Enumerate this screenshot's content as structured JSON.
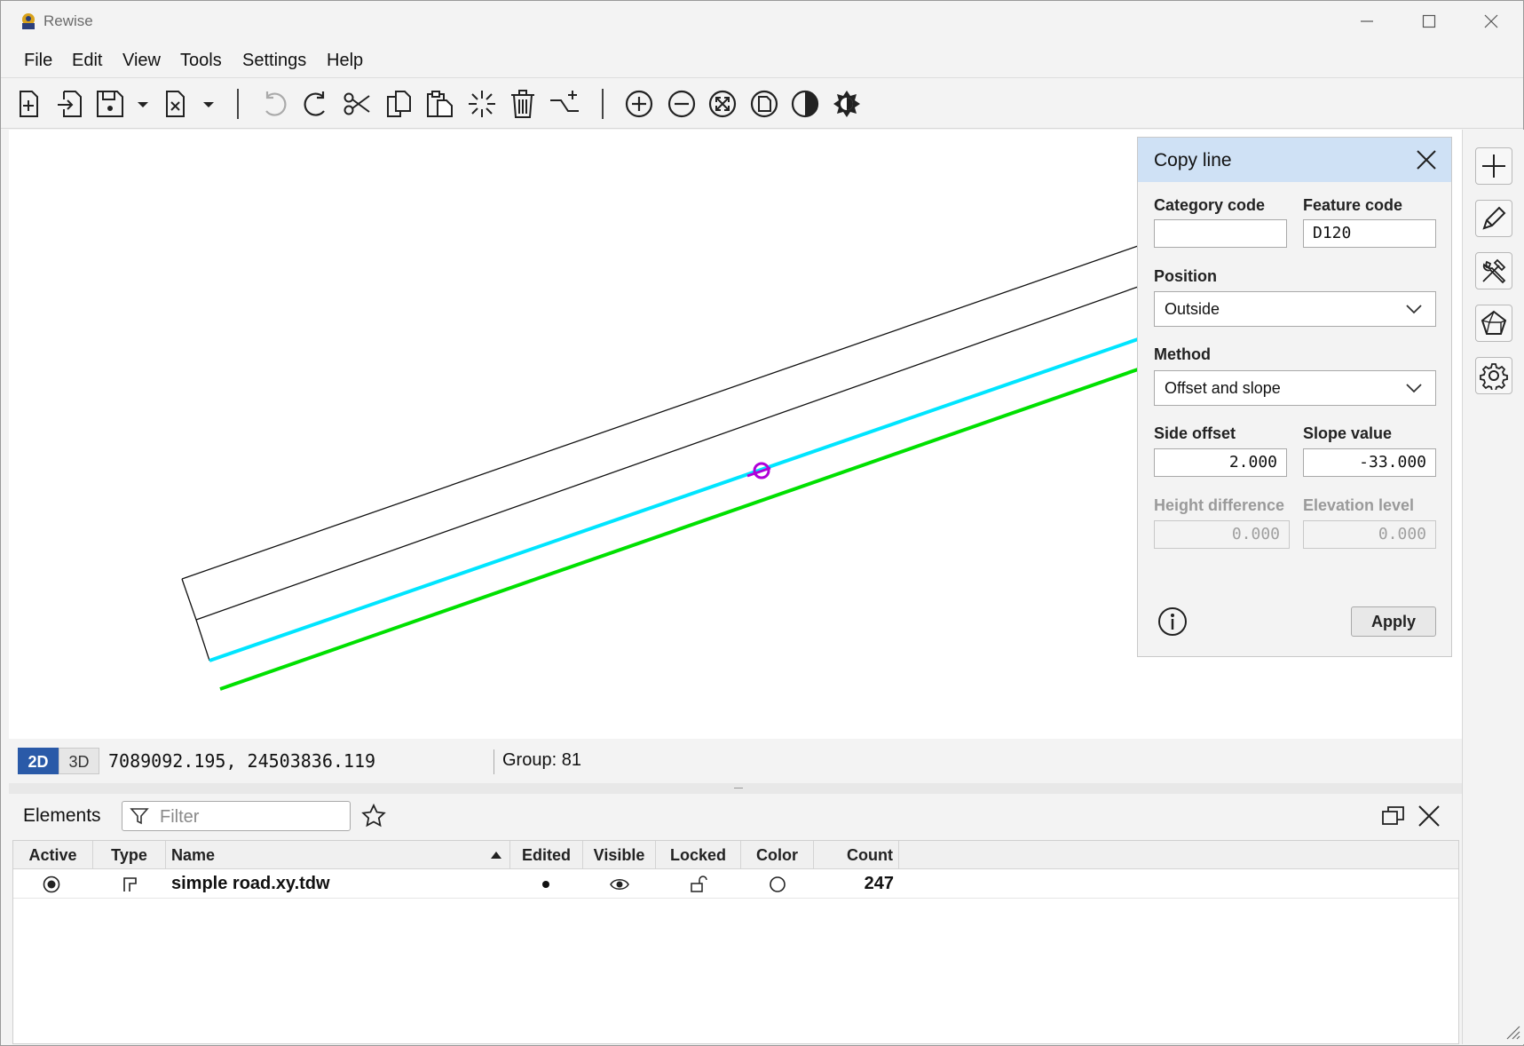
{
  "window": {
    "title": "Rewise"
  },
  "menu": [
    "File",
    "Edit",
    "View",
    "Tools",
    "Settings",
    "Help"
  ],
  "dialog": {
    "title": "Copy line",
    "category_code_label": "Category code",
    "category_code_value": "",
    "feature_code_label": "Feature code",
    "feature_code_value": "D120",
    "position_label": "Position",
    "position_value": "Outside",
    "method_label": "Method",
    "method_value": "Offset and slope",
    "side_offset_label": "Side offset",
    "side_offset_value": "2.000",
    "slope_value_label": "Slope value",
    "slope_value_value": "-33.000",
    "height_difference_label": "Height difference",
    "height_difference_value": "0.000",
    "elevation_level_label": "Elevation level",
    "elevation_level_value": "0.000",
    "apply_label": "Apply"
  },
  "status": {
    "mode_2d": "2D",
    "mode_3d": "3D",
    "coordinates": "7089092.195, 24503836.119",
    "group": "Group: 81"
  },
  "elements": {
    "title": "Elements",
    "filter_placeholder": "Filter",
    "columns": [
      "Active",
      "Type",
      "Name",
      "Edited",
      "Visible",
      "Locked",
      "Color",
      "Count"
    ],
    "rows": [
      {
        "name": "simple road.xy.tdw",
        "count": "247"
      }
    ]
  },
  "colors": {
    "accent_line": "#00e5ff",
    "offset_line": "#00e000",
    "marker": "#b000d8",
    "dialog_header": "#cfe1f5",
    "mode_active": "#2a5aa8"
  }
}
